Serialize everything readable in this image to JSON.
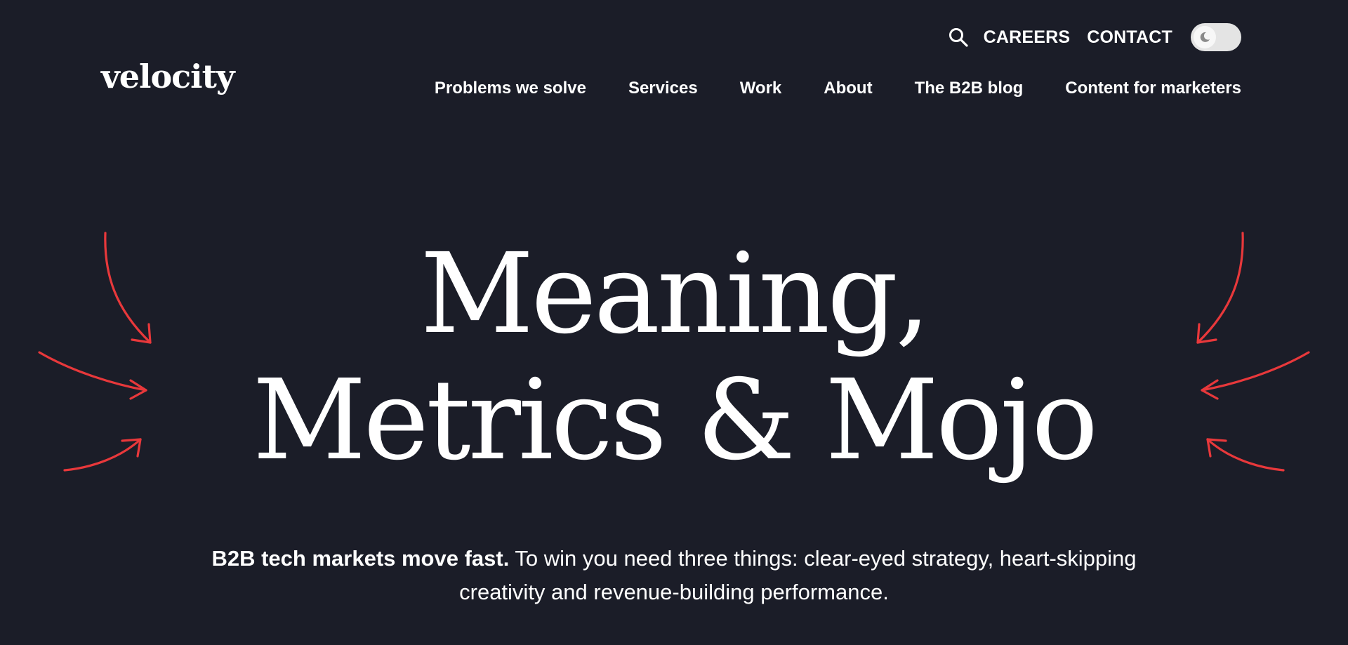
{
  "brand": {
    "logo_text": "velocity"
  },
  "utility_nav": {
    "search_icon": "search-icon",
    "careers_label": "CAREERS",
    "contact_label": "CONTACT",
    "theme_toggle_icon": "moon-icon"
  },
  "main_nav": {
    "items": [
      {
        "label": "Problems we solve"
      },
      {
        "label": "Services"
      },
      {
        "label": "Work"
      },
      {
        "label": "About"
      },
      {
        "label": "The B2B blog"
      },
      {
        "label": "Content for marketers"
      }
    ]
  },
  "hero": {
    "headline_line1": "Meaning,",
    "headline_line2": "Metrics & Mojo",
    "intro_bold": "B2B tech markets move fast.",
    "intro_rest": " To win you need three things: clear-eyed strategy, heart-skipping creativity and revenue-building performance."
  },
  "colors": {
    "background": "#1b1d28",
    "text": "#ffffff",
    "accent_arrows": "#e8383b",
    "toggle_bg": "#e4e4e4"
  }
}
